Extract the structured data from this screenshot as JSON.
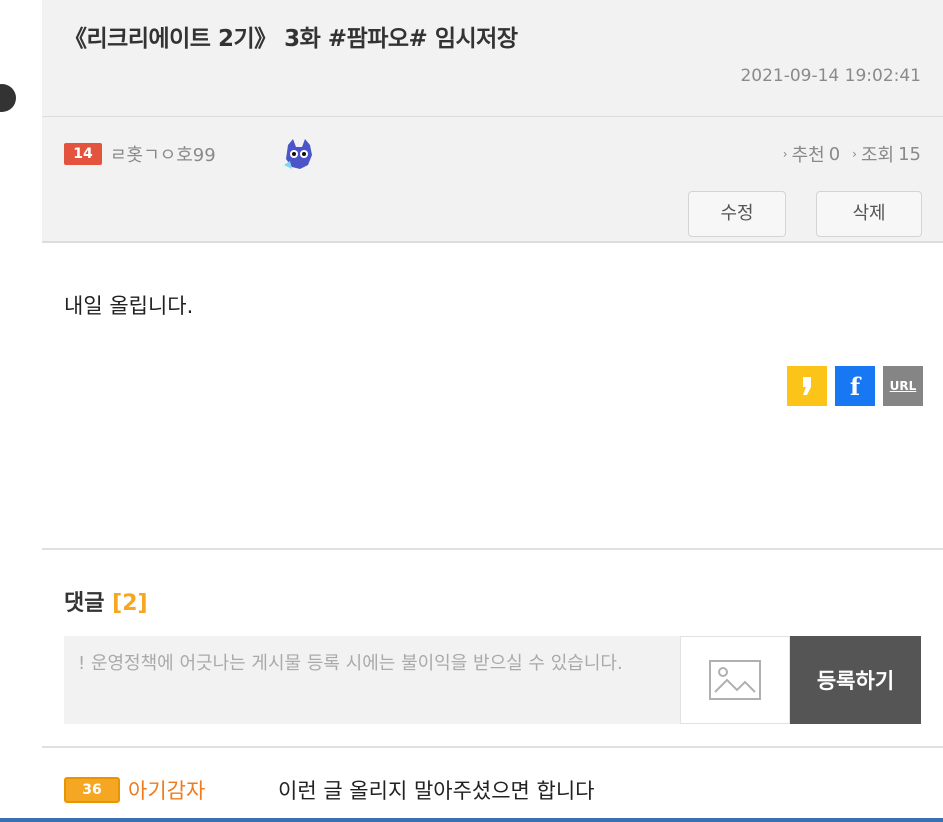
{
  "post": {
    "title": "《리크리에이트 2기》 3화 #팜파오# 임시저장",
    "date": "2021-09-14 19:02:41",
    "author_level": "14",
    "author": "ㄹ홋ㄱㅇ호99",
    "recommend_label": "추천",
    "recommend_count": "0",
    "views_label": "조회",
    "views_count": "15",
    "edit_label": "수정",
    "delete_label": "삭제",
    "body": "내일 올립니다."
  },
  "share": {
    "kakao_icon": "kakao-icon",
    "facebook_label": "f",
    "url_label": "URL"
  },
  "comments": {
    "title": "댓글",
    "count": "[2]",
    "input_placeholder": "! 운영정책에 어긋나는 게시물 등록 시에는 불이익을 받으실 수 있습니다.",
    "submit_label": "등록하기",
    "items": [
      {
        "level": "36",
        "author": "아기감자",
        "text": "이런 글 올리지 말아주셨으면 합니다"
      }
    ]
  },
  "colors": {
    "accent": "#f5a623",
    "level_red": "#e4533d",
    "facebook": "#1877f2",
    "kakao": "#fcc419"
  }
}
